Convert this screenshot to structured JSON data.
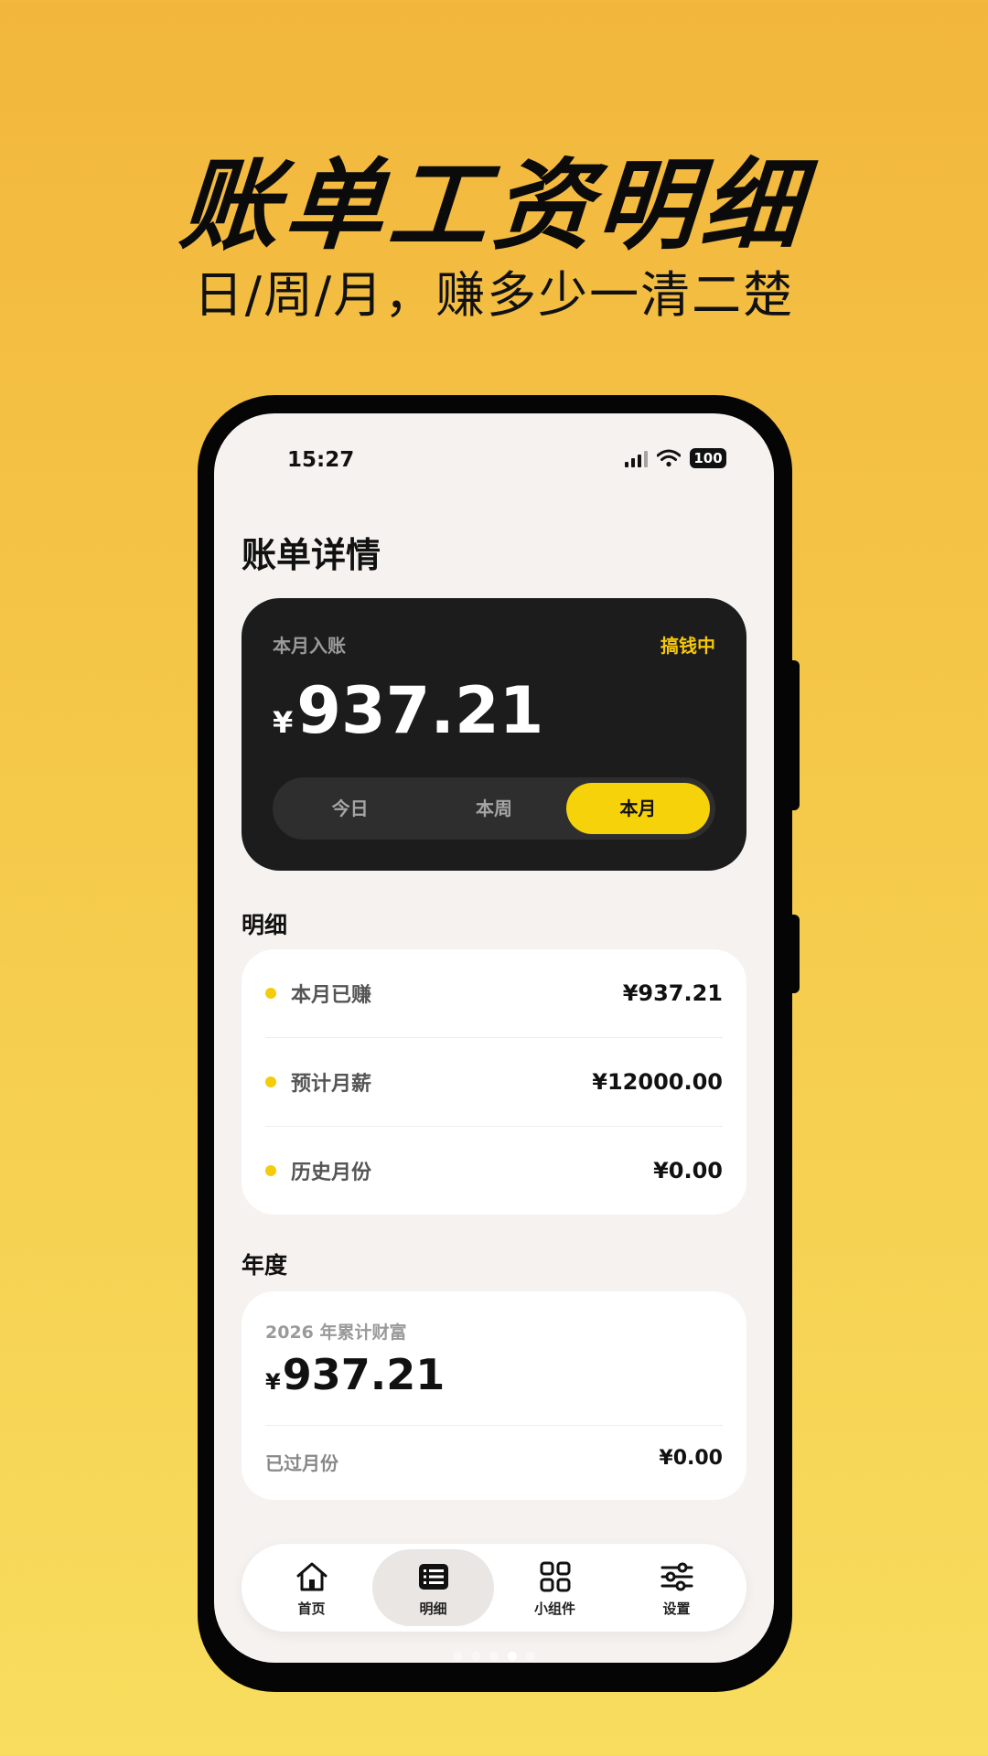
{
  "promo": {
    "title": "账单工资明细",
    "subtitle": "日/周/月，赚多少一清二楚"
  },
  "status_bar": {
    "time": "15:27",
    "battery": "100"
  },
  "page": {
    "title": "账单详情"
  },
  "income_card": {
    "label": "本月入账",
    "status": "搞钱中",
    "currency": "¥",
    "amount": "937.21",
    "tabs": [
      {
        "label": "今日",
        "active": false
      },
      {
        "label": "本周",
        "active": false
      },
      {
        "label": "本月",
        "active": true
      }
    ]
  },
  "details": {
    "section_title": "明细",
    "rows": [
      {
        "label": "本月已赚",
        "value": "¥937.21"
      },
      {
        "label": "预计月薪",
        "value": "¥12000.00"
      },
      {
        "label": "历史月份",
        "value": "¥0.00"
      }
    ]
  },
  "annual": {
    "section_title": "年度",
    "label": "2026 年累计财富",
    "currency": "¥",
    "amount": "937.21",
    "footer_label": "已过月份",
    "footer_value": "¥0.00"
  },
  "tab_bar": {
    "items": [
      {
        "label": "首页",
        "icon": "home-icon",
        "active": false
      },
      {
        "label": "明细",
        "icon": "list-icon",
        "active": true
      },
      {
        "label": "小组件",
        "icon": "grid-icon",
        "active": false
      },
      {
        "label": "设置",
        "icon": "sliders-icon",
        "active": false
      }
    ]
  },
  "pager": {
    "count": 5,
    "active_index": 3
  },
  "colors": {
    "accent": "#f6d20a",
    "card_dark": "#1c1c1c",
    "background_top": "#f2b63c",
    "background_bottom": "#f8dd5e"
  }
}
